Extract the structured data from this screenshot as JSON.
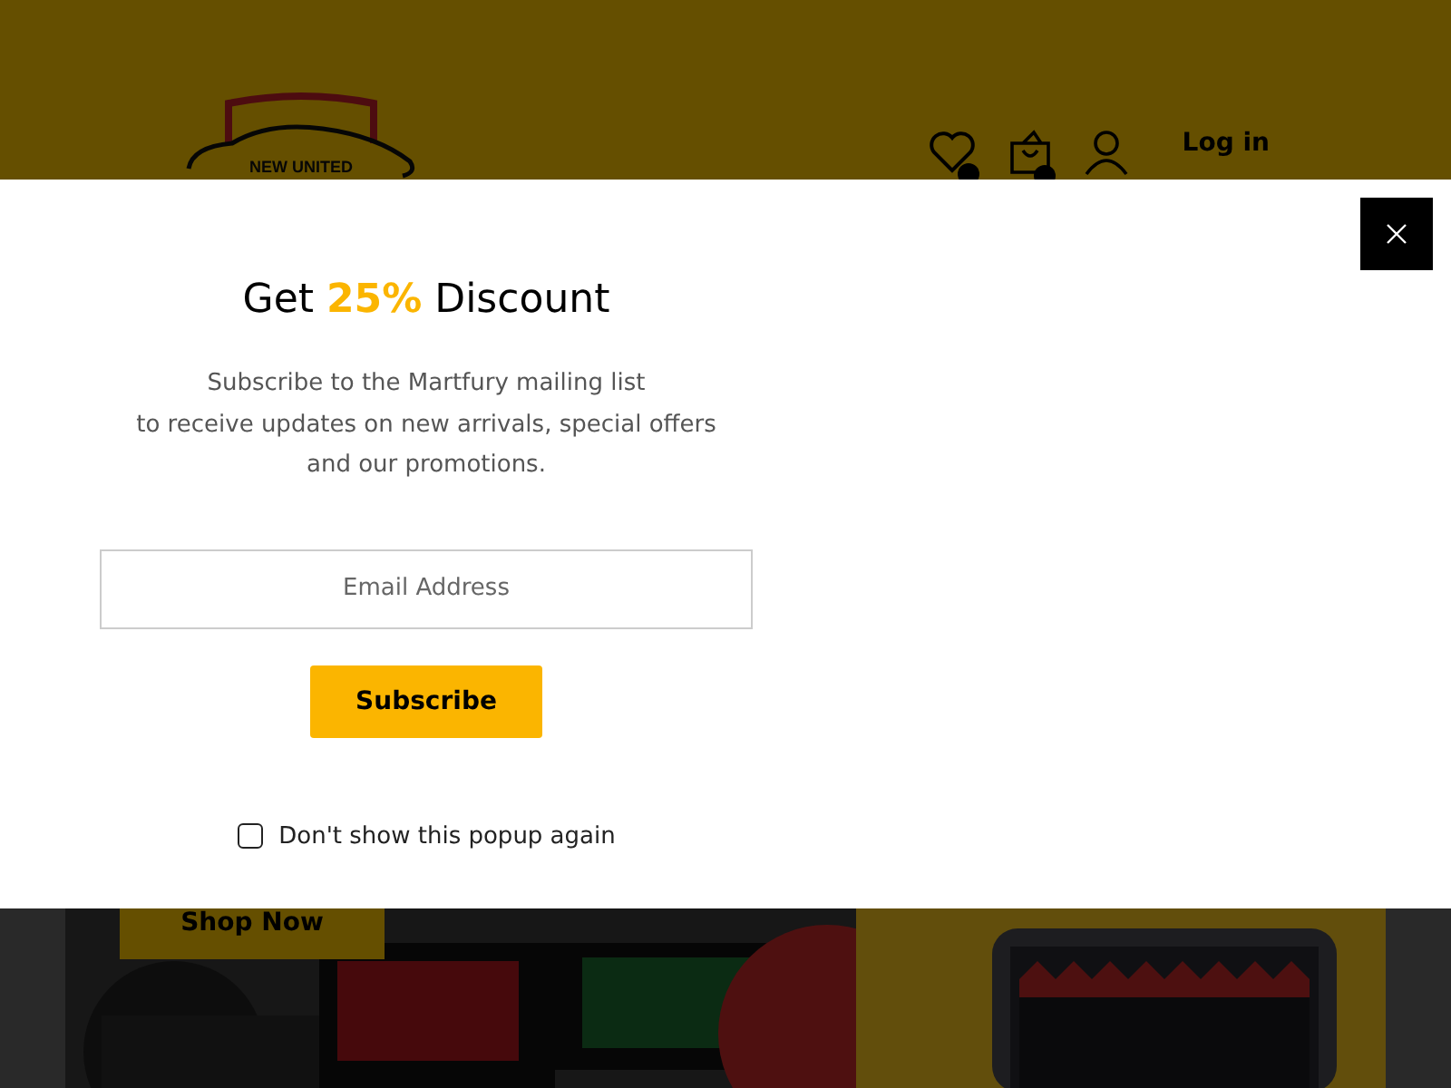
{
  "header": {
    "logo_text": "NEW UNITED",
    "login": "Log in"
  },
  "banner": {
    "button": "Shop Now"
  },
  "popup": {
    "title": {
      "prefix": "Get",
      "highlight": "25%",
      "suffix": "Discount"
    },
    "description": [
      "Subscribe to the Martfury mailing list",
      "to receive updates on new arrivals, special offers",
      "and our promotions."
    ],
    "email": {
      "placeholder": "Email Address"
    },
    "subscribe": "Subscribe",
    "dont_show": {
      "label": "Don't show this popup again",
      "checked": false
    }
  }
}
